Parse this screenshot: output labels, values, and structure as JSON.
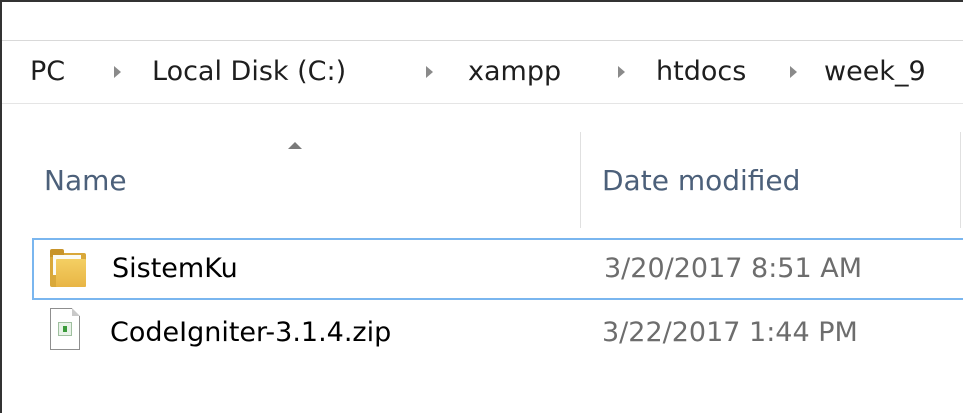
{
  "breadcrumb": {
    "items": [
      "PC",
      "Local Disk (C:)",
      "xampp",
      "htdocs",
      "week_9"
    ],
    "partial_prefix": ":"
  },
  "columns": {
    "name": "Name",
    "date_modified": "Date modified",
    "sort": "ascending"
  },
  "files": [
    {
      "name": "SistemKu",
      "date_modified": "3/20/2017 8:51 AM",
      "type_icon": "folder-icon",
      "selected": true
    },
    {
      "name": "CodeIgniter-3.1.4.zip",
      "date_modified": "3/22/2017 1:44 PM",
      "type_icon": "zip-file-icon",
      "selected": false
    }
  ],
  "colors": {
    "selection_border": "#7ab6ef",
    "header_text": "#4c607a",
    "date_text": "#6d6d6d"
  }
}
